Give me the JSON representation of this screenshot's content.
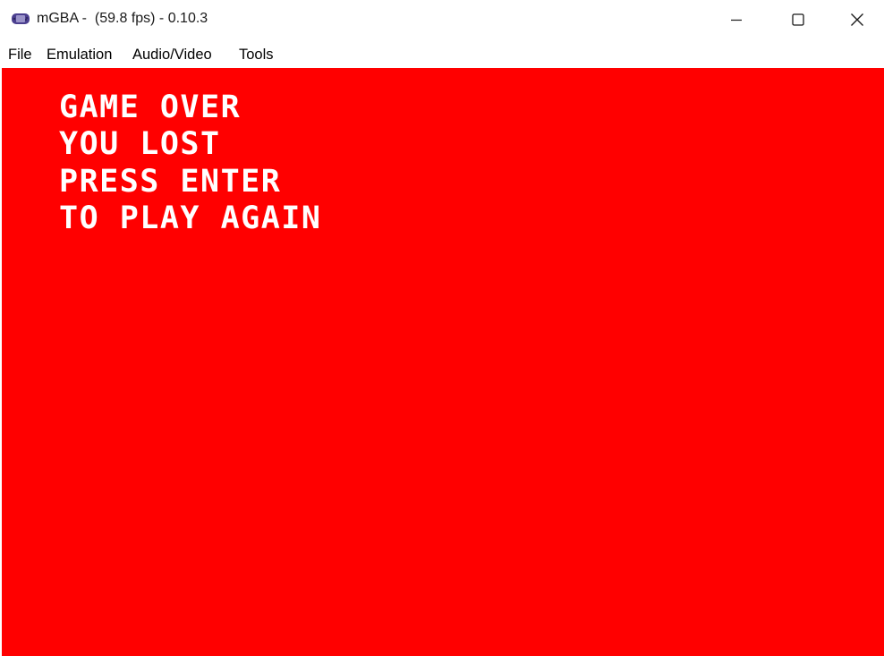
{
  "window": {
    "title": "mGBA -  (59.8 fps) - 0.10.3",
    "icon": "gba-console-icon",
    "controls": {
      "minimize_icon": "minimize-icon",
      "maximize_icon": "maximize-icon",
      "close_icon": "close-icon"
    }
  },
  "menubar": {
    "items": [
      {
        "label": "File"
      },
      {
        "label": "Emulation"
      },
      {
        "label": "Audio/Video"
      },
      {
        "label": "Tools"
      }
    ]
  },
  "game_screen": {
    "background_color": "#ff0000",
    "text_color": "#ffffff",
    "lines": [
      "GAME OVER",
      "YOU LOST",
      "PRESS ENTER",
      "TO PLAY AGAIN"
    ]
  }
}
